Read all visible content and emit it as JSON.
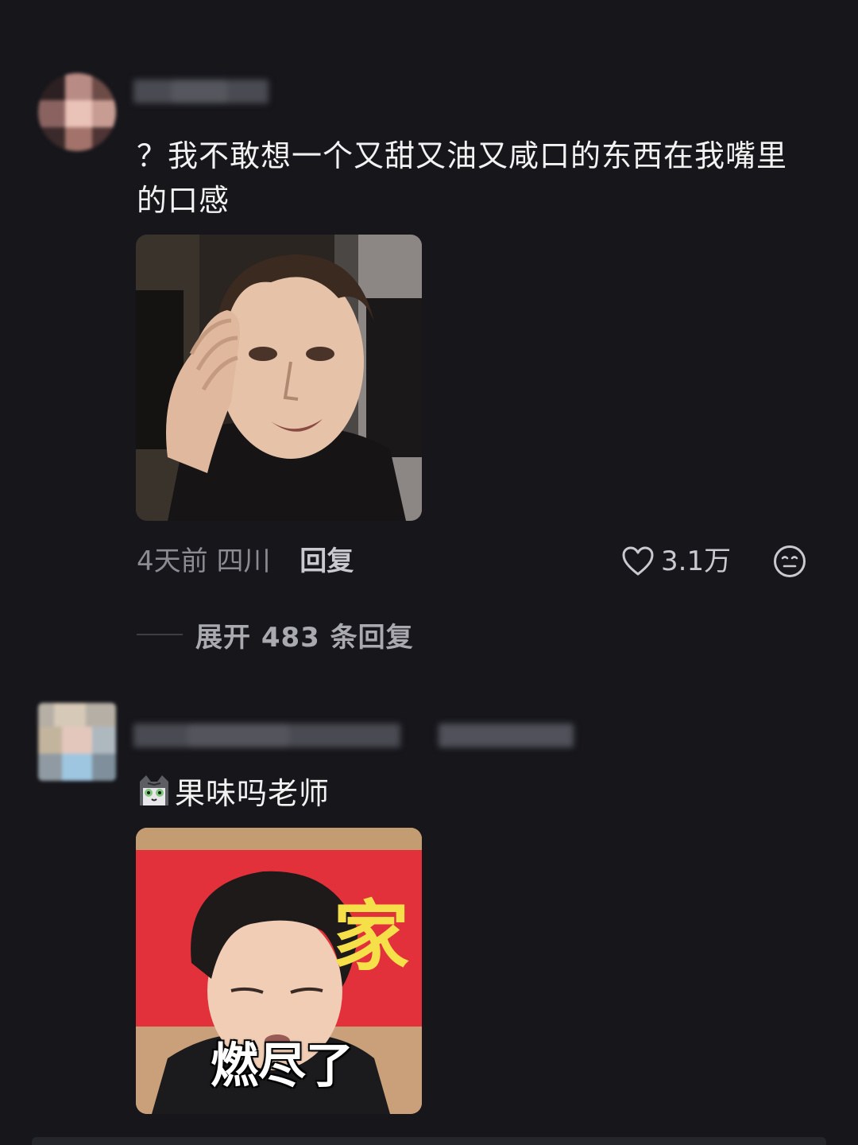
{
  "comments": [
    {
      "text": "？我不敢想一个又甜又油又咸口的东西在我嘴里的口感",
      "meta": {
        "time_location": "4天前 四川",
        "reply_label": "回复",
        "like_count": "3.1万"
      },
      "expand_label": "展开 483 条回复"
    },
    {
      "emoji": "cat-emoji",
      "text": "果味吗老师",
      "image_caption": "燃尽了",
      "banner_char": "家"
    }
  ],
  "icons": {
    "like": "heart-outline-icon",
    "emoji": "neutral-face-icon"
  },
  "colors": {
    "background": "#16161b",
    "text_primary": "#f2f2f2",
    "text_secondary": "#8b8b92"
  }
}
